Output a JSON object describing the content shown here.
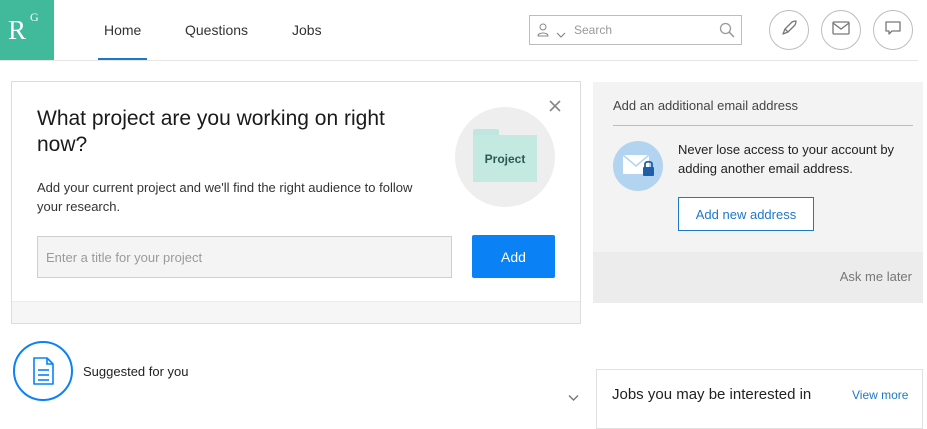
{
  "brand": {
    "logo_r": "R",
    "logo_g": "G",
    "color": "#40ba9b"
  },
  "nav": {
    "tabs": [
      {
        "label": "Home",
        "active": true
      },
      {
        "label": "Questions",
        "active": false
      },
      {
        "label": "Jobs",
        "active": false
      }
    ]
  },
  "search": {
    "placeholder": "Search",
    "icon": "search-icon"
  },
  "header_icons": [
    "rocket-icon",
    "mail-icon",
    "chat-icon"
  ],
  "project_card": {
    "title": "What project are you working on right now?",
    "description": "Add your current project and we'll find the right audience to follow your research.",
    "folder_label": "Project",
    "input_placeholder": "Enter a title for your project",
    "add_label": "Add"
  },
  "email_panel": {
    "heading": "Add an additional email address",
    "message": "Never lose access to your account by adding another email address.",
    "button_label": "Add new address",
    "ask_later": "Ask me later"
  },
  "suggested": {
    "label": "Suggested for you"
  },
  "jobs": {
    "title": "Jobs you may be interested in",
    "view_more": "View more"
  },
  "colors": {
    "accent": "#0a82f5",
    "link": "#1e78c8",
    "brand": "#40ba9b"
  }
}
